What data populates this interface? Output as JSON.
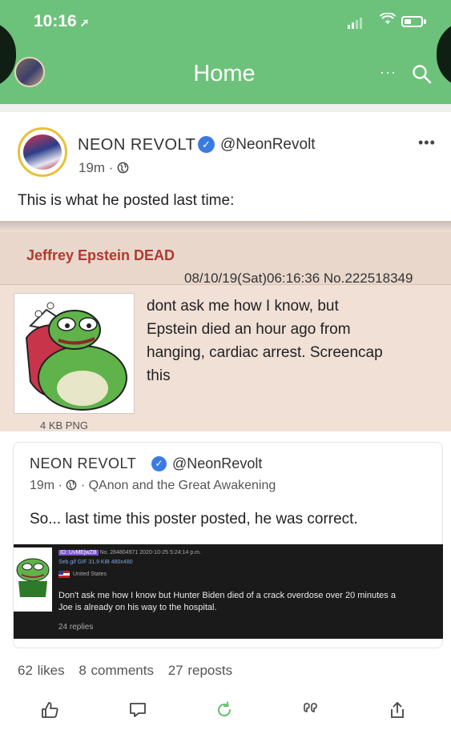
{
  "status_bar": {
    "time": "10:16",
    "location_arrow": "location-arrow-icon"
  },
  "header": {
    "title": "Home",
    "more": "···",
    "search_icon": "search-icon"
  },
  "post": {
    "author_name": "NEON REVOLT",
    "verified_icon": "verified-check-icon",
    "handle": "@NeonRevolt",
    "more": "•••",
    "time": "19m ·",
    "visibility_icon": "globe-icon",
    "text": "This is what he posted last time:",
    "embedded_image": {
      "subject": "Jeffrey Epstein DEAD",
      "date_line": "08/10/19(Sat)06:16:36 No.222518349",
      "body_lines": [
        "dont ask me how I know, but",
        "Epstein died an hour ago from",
        "hanging, cardiac arrest. Screencap",
        "this"
      ],
      "file_label": "4 KB PNG"
    },
    "quoted": {
      "author_name": "NEON REVOLT",
      "handle": "@NeonRevolt",
      "time": "19m ·",
      "group": "· QAnon and the Great Awakening",
      "text": "So... last time this poster posted, he was correct.",
      "embedded_image": {
        "id_label": "ID: UvMEjwZB",
        "id_rest": "No. 284804971 2020-10-25 5:24:14 p.m.",
        "file_line": "Seb.gif GIF 31.9 KiB 480x480",
        "country": "United States",
        "body_lines": [
          "Don't ask me how I know but Hunter Biden died of a crack overdose over 20 minutes a",
          "Joe is already on his way to the hospital."
        ],
        "replies": "24 replies"
      }
    },
    "stats": {
      "likes": "62 likes",
      "comments": "8 comments",
      "reposts": "27 reposts"
    }
  },
  "actions": {
    "like_icon": "thumbs-up-icon",
    "comment_icon": "comment-icon",
    "repost_icon": "refresh-icon",
    "quote_icon": "quote-icon",
    "share_icon": "share-icon"
  },
  "colors": {
    "header_bg": "#6dc27b",
    "verified": "#3a7be0",
    "chan_bg": "#f0e0d6",
    "chan_subject": "#b03a2e",
    "repost_icon": "#5fc26e"
  }
}
